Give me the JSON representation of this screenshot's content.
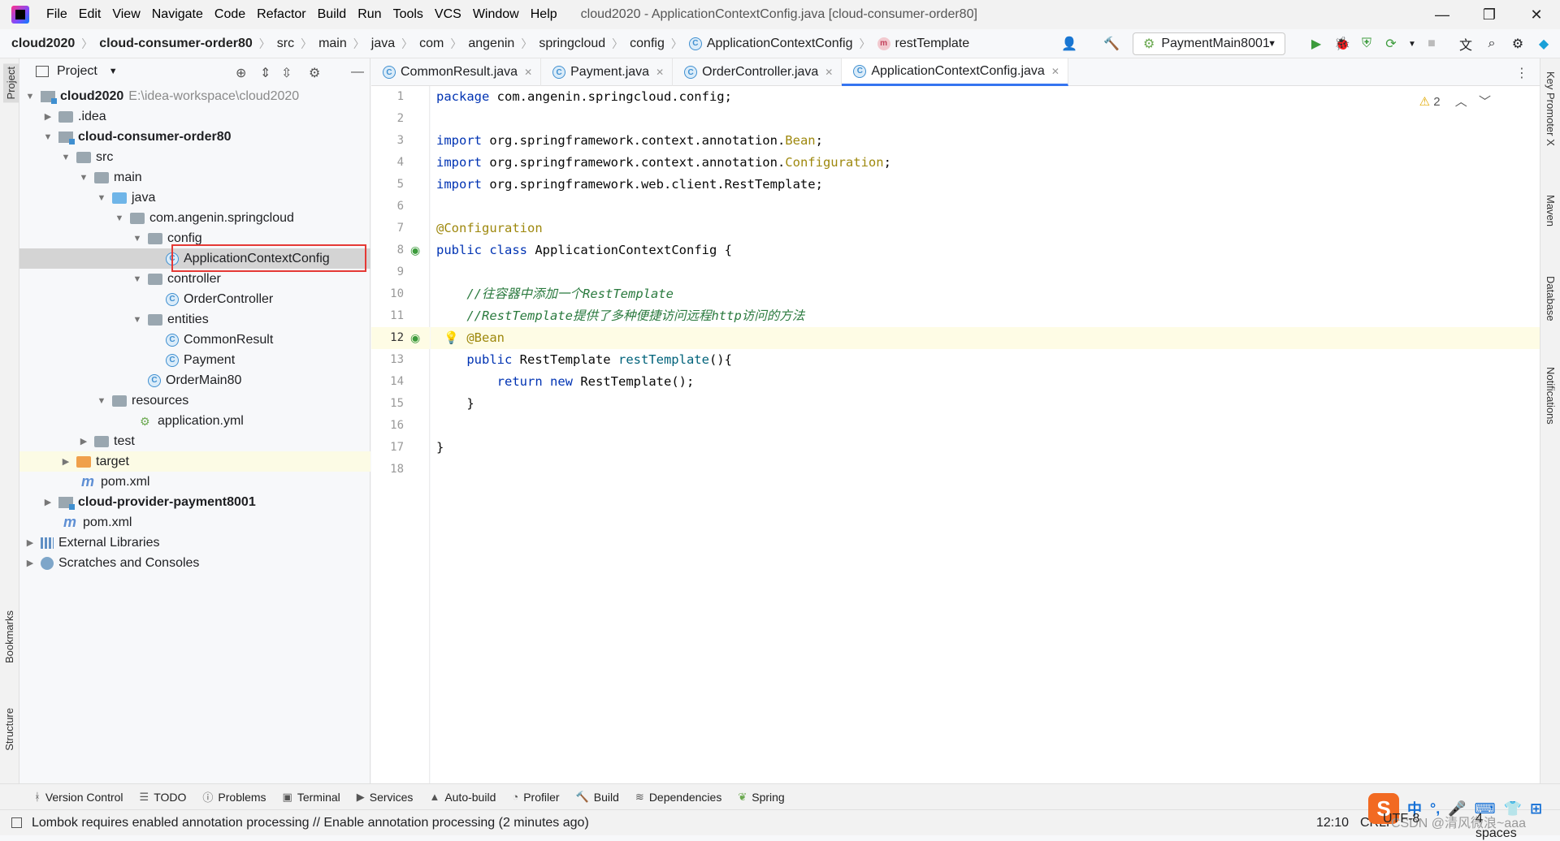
{
  "menubar": {
    "items": [
      "File",
      "Edit",
      "View",
      "Navigate",
      "Code",
      "Refactor",
      "Build",
      "Run",
      "Tools",
      "VCS",
      "Window",
      "Help"
    ],
    "title": "cloud2020 - ApplicationContextConfig.java [cloud-consumer-order80]"
  },
  "breadcrumb": [
    "cloud2020",
    "cloud-consumer-order80",
    "src",
    "main",
    "java",
    "com",
    "angenin",
    "springcloud",
    "config",
    "ApplicationContextConfig",
    "restTemplate"
  ],
  "run_config": "PaymentMain8001",
  "project_panel": {
    "title": "Project",
    "tree": [
      {
        "label": "cloud2020",
        "hint": "E:\\idea-workspace\\cloud2020"
      },
      {
        "label": ".idea"
      },
      {
        "label": "cloud-consumer-order80"
      },
      {
        "label": "src"
      },
      {
        "label": "main"
      },
      {
        "label": "java"
      },
      {
        "label": "com.angenin.springcloud"
      },
      {
        "label": "config"
      },
      {
        "label": "ApplicationContextConfig"
      },
      {
        "label": "controller"
      },
      {
        "label": "OrderController"
      },
      {
        "label": "entities"
      },
      {
        "label": "CommonResult"
      },
      {
        "label": "Payment"
      },
      {
        "label": "OrderMain80"
      },
      {
        "label": "resources"
      },
      {
        "label": "application.yml"
      },
      {
        "label": "test"
      },
      {
        "label": "target"
      },
      {
        "label": "pom.xml"
      },
      {
        "label": "cloud-provider-payment8001"
      },
      {
        "label": "pom.xml"
      },
      {
        "label": "External Libraries"
      },
      {
        "label": "Scratches and Consoles"
      }
    ]
  },
  "tabs": [
    "CommonResult.java",
    "Payment.java",
    "OrderController.java",
    "ApplicationContextConfig.java"
  ],
  "editor": {
    "line_numbers": [
      "1",
      "2",
      "3",
      "4",
      "5",
      "6",
      "7",
      "8",
      "9",
      "10",
      "11",
      "12",
      "13",
      "14",
      "15",
      "16",
      "17",
      "18"
    ],
    "warnings": "2",
    "code": {
      "l1_kw": "package",
      "l1_rest": " com.angenin.springcloud.config;",
      "l3_kw": "import",
      "l3_rest": " org.springframework.context.annotation.",
      "l3_ann": "Bean",
      "l3_end": ";",
      "l4_kw": "import",
      "l4_rest": " org.springframework.context.annotation.",
      "l4_ann": "Configuration",
      "l4_end": ";",
      "l5_kw": "import",
      "l5_rest": " org.springframework.web.client.RestTemplate;",
      "l7_ann": "@Configuration",
      "l8_kw1": "public",
      "l8_kw2": "class",
      "l8_rest": " ApplicationContextConfig {",
      "l10_cm": "    //往容器中添加一个RestTemplate",
      "l11_cm": "    //RestTemplate提供了多种便捷访问远程http访问的方法",
      "l12_ann": "@Bean",
      "l13_kw": "public",
      "l13_type": " RestTemplate ",
      "l13_fn": "restTemplate",
      "l13_end": "(){",
      "l14_kw1": "return",
      "l14_kw2": "new",
      "l14_rest": " RestTemplate();",
      "l15": "    }",
      "l17": "}"
    }
  },
  "left_stripe": [
    "Project",
    "Bookmarks",
    "Structure"
  ],
  "right_stripe": [
    "Key Promoter X",
    "Maven",
    "Database",
    "Notifications"
  ],
  "bottom_tools": [
    "Version Control",
    "TODO",
    "Problems",
    "Terminal",
    "Services",
    "Auto-build",
    "Profiler",
    "Build",
    "Dependencies",
    "Spring"
  ],
  "status": {
    "message": "Lombok requires enabled annotation processing // Enable annotation processing (2 minutes ago)",
    "position": "12:10",
    "line_sep": "CRLF",
    "encoding": "UTF-8",
    "indent": "4 spaces",
    "watermark": "CSDN @清风微浪~aaa"
  },
  "ime": [
    "中",
    "°,",
    "🎤",
    "⌨",
    "👕",
    "⊞"
  ]
}
